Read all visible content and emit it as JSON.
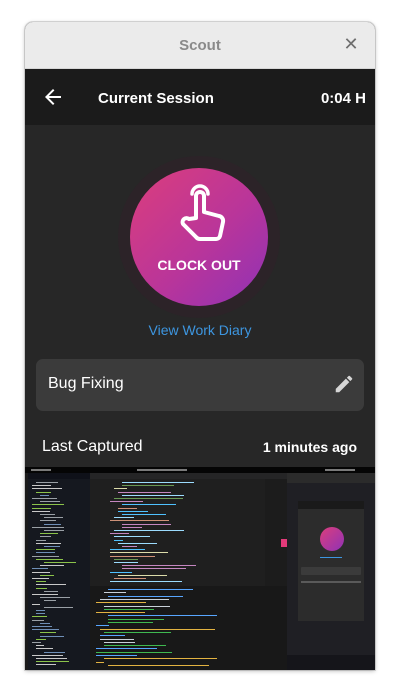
{
  "window": {
    "title": "Scout",
    "close_glyph": "✕"
  },
  "appbar": {
    "back_icon": "arrow-left-icon",
    "title": "Current Session",
    "elapsed": "0:04 H"
  },
  "clock": {
    "label": "CLOCK OUT",
    "icon": "hand-pointer-icon",
    "gradient": [
      "#dc3e7c",
      "#b9359a",
      "#8f32b6"
    ]
  },
  "work_diary": {
    "link_label": "View Work Diary",
    "color": "#3d96e0"
  },
  "task": {
    "name": "Bug Fixing",
    "edit_icon": "pencil-icon"
  },
  "last_captured": {
    "label": "Last Captured",
    "time_ago": "1 minutes ago"
  },
  "screenshot": {
    "image": "desktop-screenshot-thumbnail"
  },
  "colors": {
    "app_background": "#272727",
    "appbar_background": "#1b1b1b",
    "card_background": "#3b3b3b",
    "titlebar_background": "#ebebeb"
  }
}
